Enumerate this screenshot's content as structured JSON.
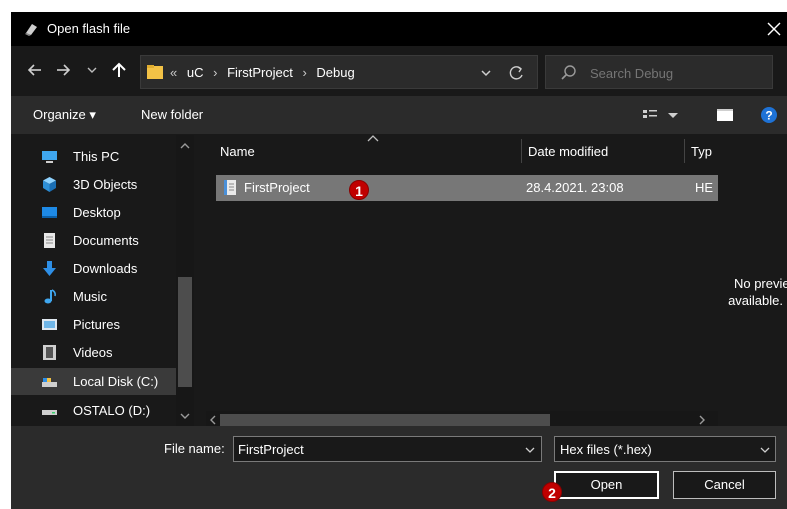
{
  "window": {
    "title": "Open flash file"
  },
  "address": {
    "crumbs": [
      "«",
      "uC",
      "FirstProject",
      "Debug"
    ]
  },
  "search": {
    "placeholder": "Search Debug"
  },
  "toolbar": {
    "organize_label": "Organize ▾",
    "new_folder_label": "New folder"
  },
  "sidebar": {
    "items": [
      {
        "label": "This PC",
        "icon": "computer-icon"
      },
      {
        "label": "3D Objects",
        "icon": "cube-icon"
      },
      {
        "label": "Desktop",
        "icon": "desktop-icon"
      },
      {
        "label": "Documents",
        "icon": "document-icon"
      },
      {
        "label": "Downloads",
        "icon": "download-icon"
      },
      {
        "label": "Music",
        "icon": "music-icon"
      },
      {
        "label": "Pictures",
        "icon": "pictures-icon"
      },
      {
        "label": "Videos",
        "icon": "videos-icon"
      },
      {
        "label": "Local Disk (C:)",
        "icon": "drive-icon",
        "selected": true
      },
      {
        "label": "OSTALO (D:)",
        "icon": "drive-icon"
      }
    ]
  },
  "filelist": {
    "columns": {
      "name": "Name",
      "date": "Date modified",
      "type": "Typ"
    },
    "files": [
      {
        "name": "FirstProject",
        "date": "28.4.2021. 23:08",
        "type": "HE"
      }
    ]
  },
  "preview": {
    "line1": "No preview",
    "line2": "available."
  },
  "bottom": {
    "file_name_label": "File name:",
    "file_name_value": "FirstProject",
    "filter_value": "Hex files (*.hex)",
    "open_label": "Open",
    "cancel_label": "Cancel"
  },
  "annotations": {
    "badge1": "1",
    "badge2": "2",
    "badge_color": "#c00000"
  }
}
